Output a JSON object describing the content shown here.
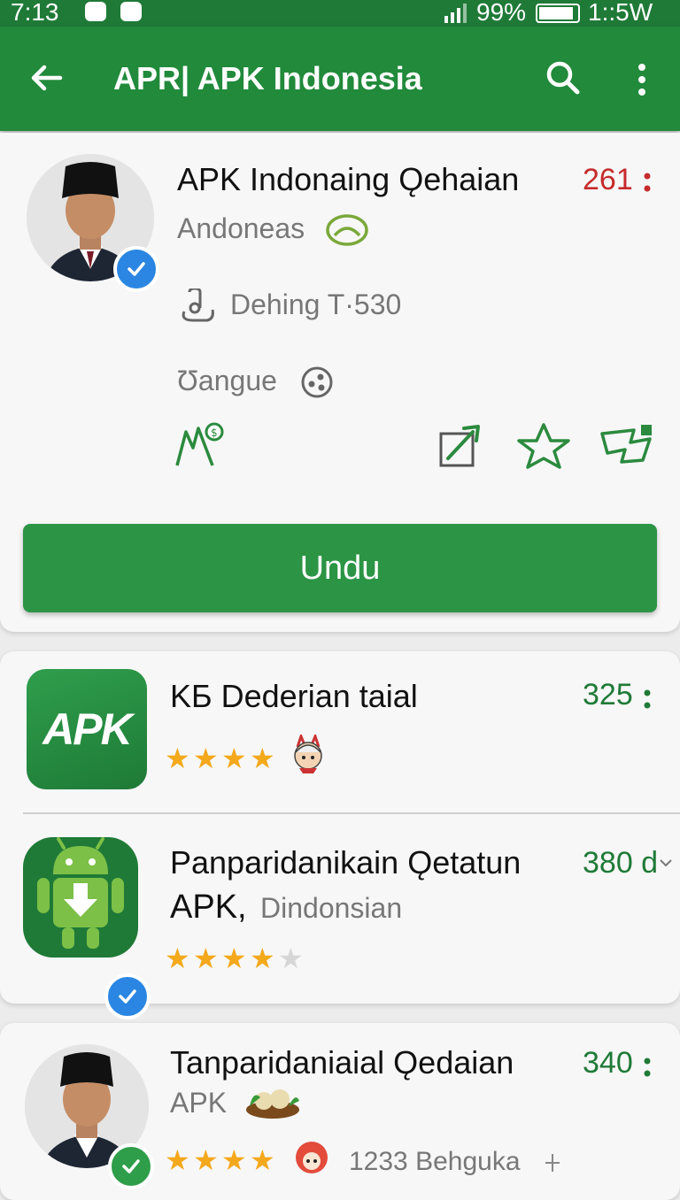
{
  "status_bar": {
    "time": "7:13",
    "battery": "99%",
    "right_time": "1::5W"
  },
  "app_bar": {
    "title": "APR| APK Indonesia",
    "icons": [
      "back-arrow-icon",
      "search-icon",
      "more-vert-icon"
    ]
  },
  "featured": {
    "title": "APK Indonaing Ǫehaian",
    "count": "261",
    "region": "Andoneas",
    "device": "Dehing T·530",
    "language": "Ʊangue",
    "download_label": "Undu"
  },
  "list": [
    {
      "title": "KБ Dederian taial",
      "count": "325",
      "rating": 4
    },
    {
      "title": "Panparidanikain Ǫetatun",
      "subtitle_bold": "APK,",
      "subtitle": "Dindonsian",
      "count": "380 d",
      "rating": 4
    },
    {
      "title": "Tanparidaniaial Ǫedaian",
      "subtitle": "APK",
      "count": "340",
      "rating": 4,
      "reviews": "1233  Behguka"
    }
  ],
  "icon_texts": {
    "apk_logo": "APK"
  },
  "colors": {
    "primary": "#218a3b",
    "accent_green": "#2b9445",
    "count_red": "#c62b2b",
    "count_green": "#1f7a37",
    "star": "#f4a81c",
    "verified_blue": "#2a86e2"
  }
}
